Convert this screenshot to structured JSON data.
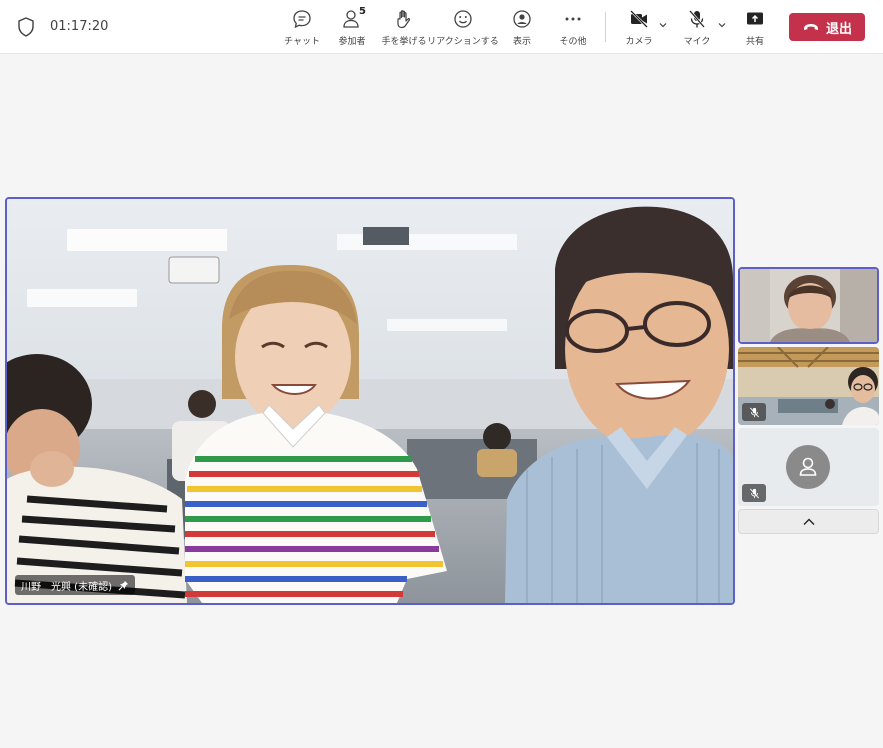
{
  "meeting": {
    "timer": "01:17:20"
  },
  "toolbar": {
    "chat_label": "チャット",
    "participants_label": "参加者",
    "participants_count": "5",
    "raise_hand_label": "手を挙げる",
    "react_label": "リアクションする",
    "view_label": "表示",
    "more_label": "その他",
    "camera_label": "カメラ",
    "mic_label": "マイク",
    "share_label": "共有",
    "leave_label": "退出"
  },
  "main_video": {
    "participant_name": "川野　光興 (未確認)"
  },
  "colors": {
    "accent": "#5b5fc7",
    "leave": "#c4314b"
  }
}
